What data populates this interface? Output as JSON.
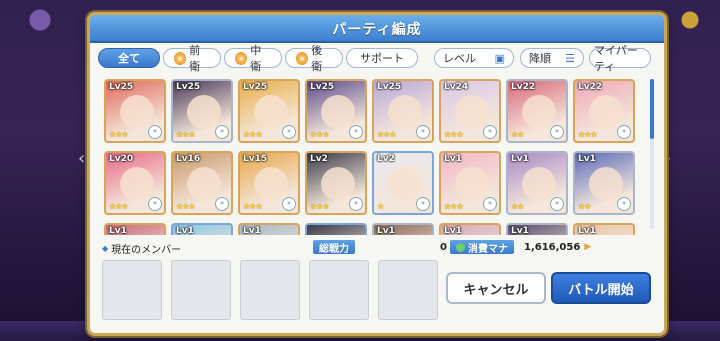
{
  "dialog": {
    "title": "パーティ編成"
  },
  "filters": {
    "tabs": [
      {
        "label": "全て",
        "active": true
      },
      {
        "label": "前衛",
        "active": false
      },
      {
        "label": "中衛",
        "active": false
      },
      {
        "label": "後衛",
        "active": false
      },
      {
        "label": "サポート",
        "active": false
      }
    ],
    "sort_label": "レベル",
    "order_label": "降順",
    "my_party_label": "マイパーティ"
  },
  "characters": [
    {
      "level": "Lv25",
      "stars": "★★★",
      "frame": "gold",
      "color": "#e06a5a"
    },
    {
      "level": "Lv25",
      "stars": "★★★",
      "frame": "silver",
      "color": "#4a3a5a"
    },
    {
      "level": "Lv25",
      "stars": "★★★",
      "frame": "gold",
      "color": "#e8b04a"
    },
    {
      "level": "Lv25",
      "stars": "★★★",
      "frame": "gold",
      "color": "#5a4a8a"
    },
    {
      "level": "Lv25",
      "stars": "★★★",
      "frame": "gold",
      "color": "#b8a8d8"
    },
    {
      "level": "Lv24",
      "stars": "★★★",
      "frame": "gold",
      "color": "#d8c8e8"
    },
    {
      "level": "Lv22",
      "stars": "★★",
      "frame": "silver",
      "color": "#d86a7a"
    },
    {
      "level": "Lv22",
      "stars": "★★★",
      "frame": "gold",
      "color": "#f0a8b8"
    },
    {
      "level": "Lv20",
      "stars": "★★★",
      "frame": "gold",
      "color": "#e86a8a"
    },
    {
      "level": "Lv16",
      "stars": "★★★",
      "frame": "gold",
      "color": "#c8986a"
    },
    {
      "level": "Lv15",
      "stars": "★★★",
      "frame": "gold",
      "color": "#e8a84a"
    },
    {
      "level": "Lv2",
      "stars": "★★★",
      "frame": "gold",
      "color": "#3a3a4a"
    },
    {
      "level": "Lv2",
      "stars": "★",
      "frame": "blue",
      "color": "#e8e8ee"
    },
    {
      "level": "Lv1",
      "stars": "★★★",
      "frame": "gold",
      "color": "#f0b8c8"
    },
    {
      "level": "Lv1",
      "stars": "★★",
      "frame": "silver",
      "color": "#a888c8"
    },
    {
      "level": "Lv1",
      "stars": "★★",
      "frame": "silver",
      "color": "#5a6ab8"
    },
    {
      "level": "Lv1",
      "stars": "",
      "frame": "gold",
      "color": "#c86a7a"
    },
    {
      "level": "Lv1",
      "stars": "",
      "frame": "blue",
      "color": "#8ac8e8"
    },
    {
      "level": "Lv1",
      "stars": "",
      "frame": "gold",
      "color": "#a8b8c8"
    },
    {
      "level": "",
      "stars": "",
      "frame": "blue",
      "color": "#3a3a4a"
    },
    {
      "level": "Lv1",
      "stars": "",
      "frame": "silver",
      "color": "#8a6a5a"
    },
    {
      "level": "Lv1",
      "stars": "",
      "frame": "gold",
      "color": "#d8a8b8"
    },
    {
      "level": "Lv1",
      "stars": "",
      "frame": "silver",
      "color": "#5a4a6a"
    },
    {
      "level": "Lv1",
      "stars": "",
      "frame": "gold",
      "color": "#e8c8a8"
    }
  ],
  "info": {
    "members_label": "現在のメンバー",
    "power_label": "総戦力",
    "power_value": "0",
    "mana_label": "消費マナ",
    "mana_value": "1,616,056"
  },
  "buttons": {
    "cancel": "キャンセル",
    "start": "バトル開始"
  },
  "colors": {
    "accent": "#3a78cc",
    "frame_gold": "#d9a35a",
    "title_bar": "#4d8fdc"
  }
}
